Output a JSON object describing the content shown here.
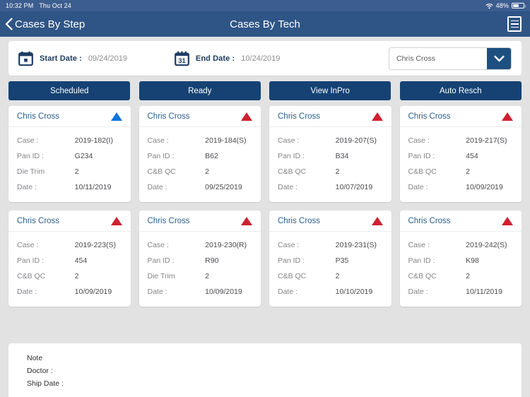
{
  "status_bar": {
    "time": "10:32 PM",
    "date": "Thu Oct 24",
    "wifi_icon": "wifi-icon",
    "battery_percent": "48%",
    "battery_level": 48
  },
  "nav": {
    "back_label": "Cases By Step",
    "back_icon": "chevron-left-icon",
    "title": "Cases By Tech",
    "menu_icon": "hamburger-menu-icon"
  },
  "filter_bar": {
    "start": {
      "icon": "calendar-icon",
      "label": "Start Date :",
      "value": "09/24/2019"
    },
    "end": {
      "icon": "calendar-31-icon",
      "label": "End Date :",
      "value": "10/24/2019"
    },
    "tech_select": {
      "value": "Chris Cross",
      "arrow_icon": "chevron-down-icon"
    }
  },
  "tabs": [
    {
      "label": "Scheduled",
      "name": "tab-scheduled"
    },
    {
      "label": "Ready",
      "name": "tab-ready"
    },
    {
      "label": "View InPro",
      "name": "tab-view-inpro"
    },
    {
      "label": "Auto Resch",
      "name": "tab-auto-resch"
    }
  ],
  "cards": [
    {
      "tech": "Chris Cross",
      "flag": "triangle-up-blue",
      "flag_color": "#1273e0",
      "fields": [
        {
          "key": "Case :",
          "value": "2019-182(I)"
        },
        {
          "key": "Pan ID :",
          "value": "G234"
        },
        {
          "key": "Die Trim",
          "value": "2"
        },
        {
          "key": "Date :",
          "value": "10/11/2019"
        }
      ]
    },
    {
      "tech": "Chris Cross",
      "flag": "triangle-up-red",
      "flag_color": "#cf2030",
      "fields": [
        {
          "key": "Case :",
          "value": "2019-184(S)"
        },
        {
          "key": "Pan ID :",
          "value": "B62"
        },
        {
          "key": "C&B QC",
          "value": "2"
        },
        {
          "key": "Date :",
          "value": "09/25/2019"
        }
      ]
    },
    {
      "tech": "Chris Cross",
      "flag": "triangle-up-red",
      "flag_color": "#cf2030",
      "fields": [
        {
          "key": "Case :",
          "value": "2019-207(S)"
        },
        {
          "key": "Pan ID :",
          "value": "B34"
        },
        {
          "key": "C&B QC",
          "value": "2"
        },
        {
          "key": "Date :",
          "value": "10/07/2019"
        }
      ]
    },
    {
      "tech": "Chris Cross",
      "flag": "triangle-up-red",
      "flag_color": "#cf2030",
      "fields": [
        {
          "key": "Case :",
          "value": "2019-217(S)"
        },
        {
          "key": "Pan ID :",
          "value": "454"
        },
        {
          "key": "C&B QC",
          "value": "2"
        },
        {
          "key": "Date :",
          "value": "10/09/2019"
        }
      ]
    },
    {
      "tech": "Chris Cross",
      "flag": "triangle-up-red",
      "flag_color": "#cf2030",
      "fields": [
        {
          "key": "Case :",
          "value": "2019-223(S)"
        },
        {
          "key": "Pan ID :",
          "value": "454"
        },
        {
          "key": "C&B QC",
          "value": "2"
        },
        {
          "key": "Date :",
          "value": "10/09/2019"
        }
      ]
    },
    {
      "tech": "Chris Cross",
      "flag": "triangle-up-red",
      "flag_color": "#cf2030",
      "fields": [
        {
          "key": "Case :",
          "value": "2019-230(R)"
        },
        {
          "key": "Pan ID :",
          "value": "R90"
        },
        {
          "key": "Die Trim",
          "value": "2"
        },
        {
          "key": "Date :",
          "value": "10/09/2019"
        }
      ]
    },
    {
      "tech": "Chris Cross",
      "flag": "triangle-up-red",
      "flag_color": "#cf2030",
      "fields": [
        {
          "key": "Case :",
          "value": "2019-231(S)"
        },
        {
          "key": "Pan ID :",
          "value": "P35"
        },
        {
          "key": "C&B QC",
          "value": "2"
        },
        {
          "key": "Date :",
          "value": "10/10/2019"
        }
      ]
    },
    {
      "tech": "Chris Cross",
      "flag": "triangle-up-red",
      "flag_color": "#cf2030",
      "fields": [
        {
          "key": "Case :",
          "value": "2019-242(S)"
        },
        {
          "key": "Pan ID :",
          "value": "K98"
        },
        {
          "key": "C&B QC",
          "value": "2"
        },
        {
          "key": "Date :",
          "value": "10/11/2019"
        }
      ]
    }
  ],
  "note_panel": {
    "lines": [
      "Note",
      "Doctor :",
      "Ship Date :"
    ]
  },
  "colors": {
    "nav_blue": "#2f5586",
    "status_blue": "#3c5d8f",
    "tab_blue": "#154273",
    "accent_blue": "#1d4f80",
    "flag_red": "#cf2030",
    "flag_blue": "#1273e0",
    "page_bg": "#e2e2e2"
  }
}
